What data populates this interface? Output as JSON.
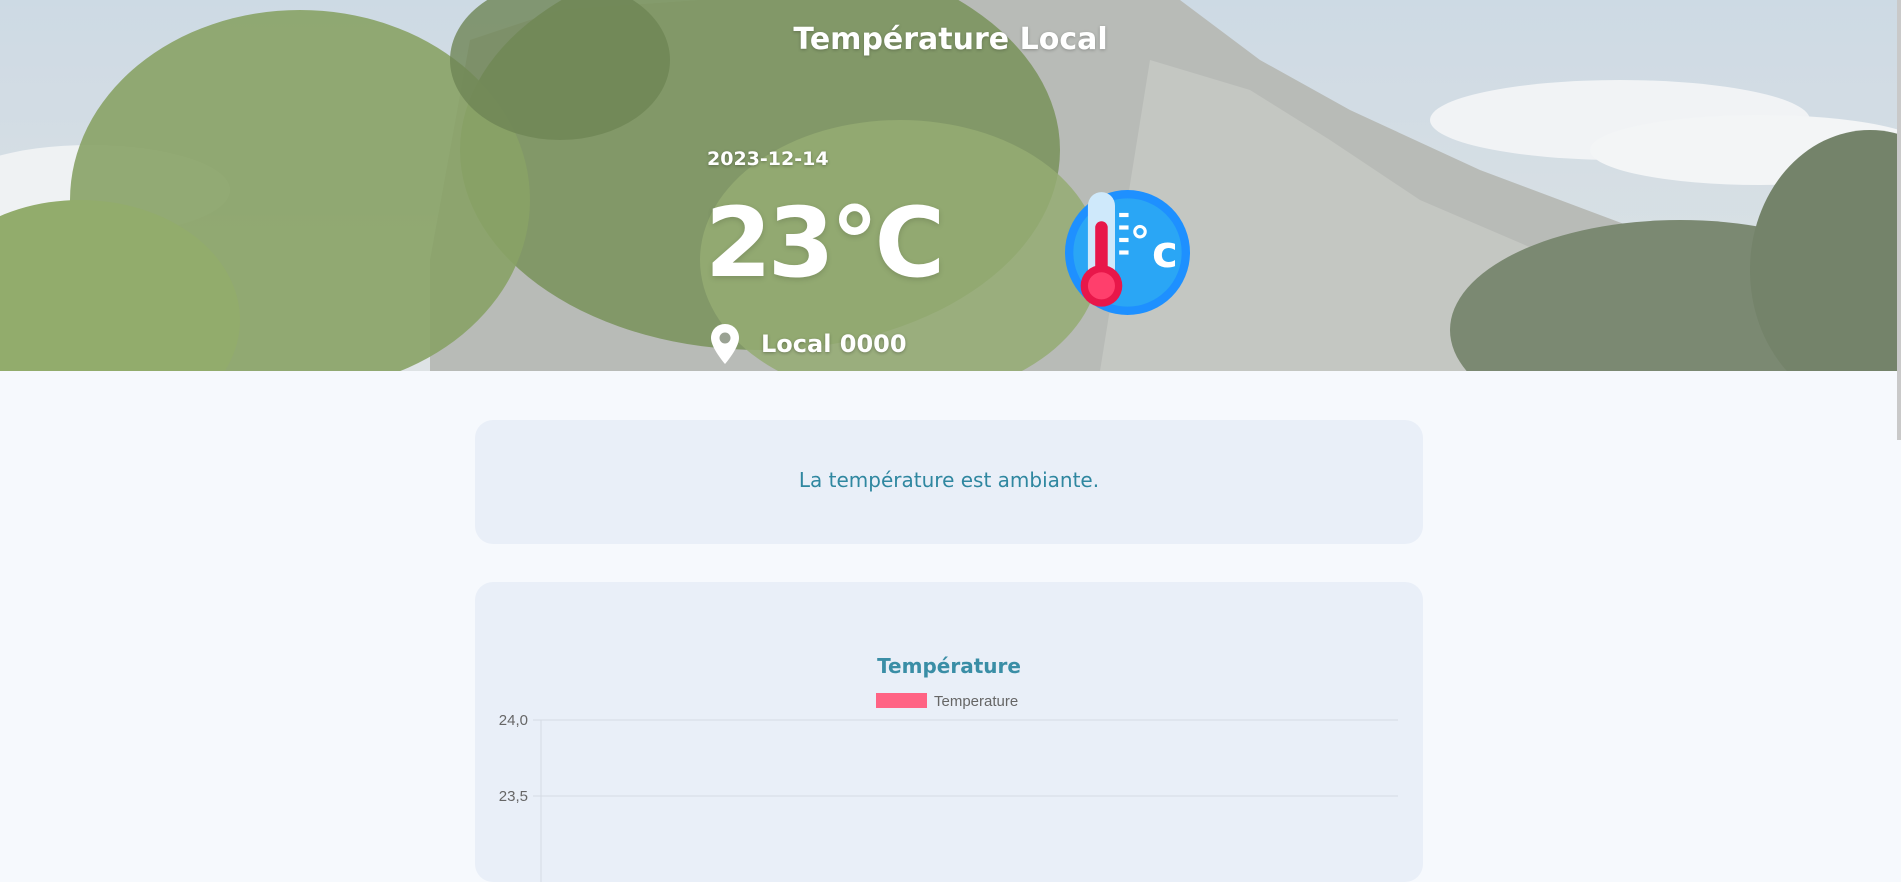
{
  "header": {
    "title": "Température Local",
    "date": "2023-12-14",
    "temperature": "23°C",
    "location": "Local 0000"
  },
  "icons": {
    "location": "location-pin-icon",
    "thermometer": "thermometer-celsius-icon"
  },
  "status": {
    "message": "La température est ambiante."
  },
  "colors": {
    "accent": "#2f87a0",
    "series": "#ff6384",
    "card": "#e9eff8",
    "page": "#f6f9fd"
  },
  "chart_data": {
    "type": "line",
    "title": "Température",
    "legend_position": "top",
    "series": [
      {
        "name": "Temperature",
        "color": "#ff6384",
        "values": []
      }
    ],
    "y_ticks": [
      "24,0",
      "23,5"
    ],
    "ylim": [
      23.5,
      24.0
    ],
    "grid": true
  }
}
